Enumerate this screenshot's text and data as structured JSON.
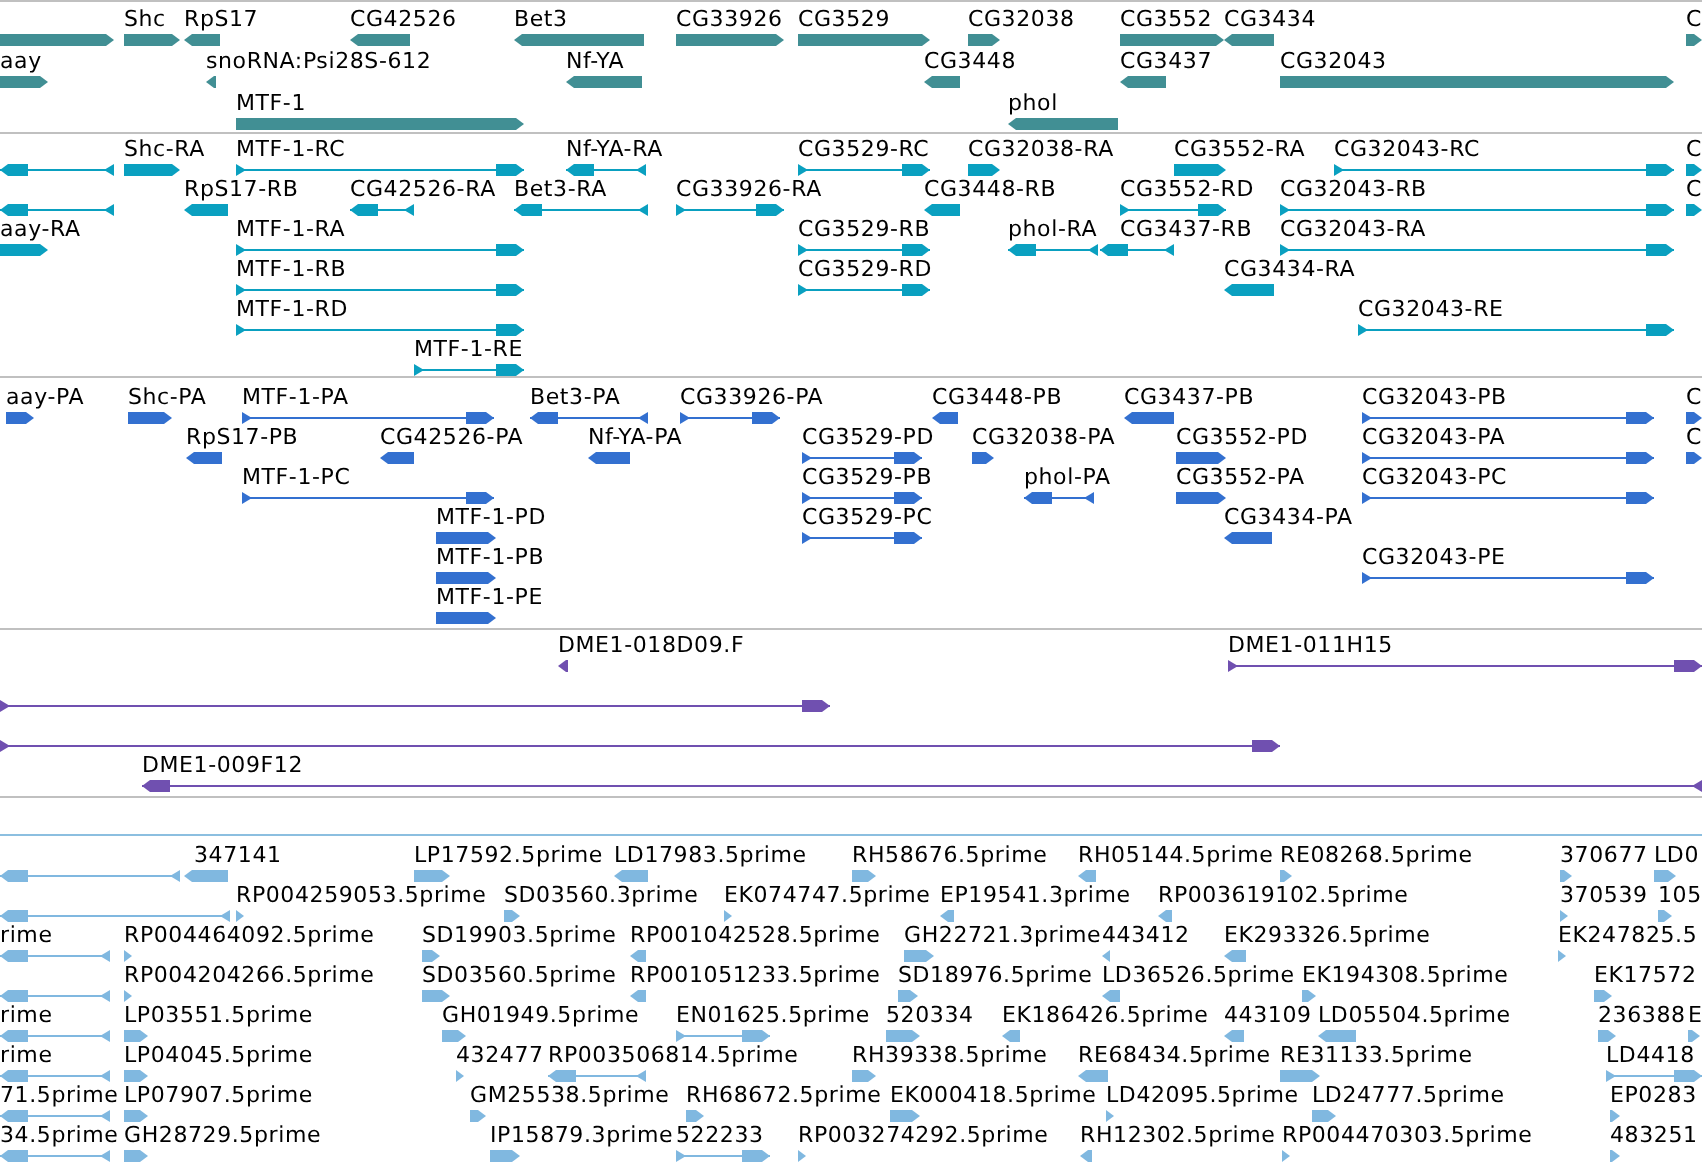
{
  "tracks": [
    {
      "kind": "gene",
      "color": "#418f94",
      "features": [
        {
          "reverse": false
        },
        {
          "label": "Shc",
          "reverse": false
        },
        {
          "label": "RpS17",
          "reverse": true
        },
        {
          "label": "CG42526",
          "reverse": true
        },
        {
          "label": "Bet3",
          "reverse": true
        },
        {
          "label": "CG33926",
          "reverse": false
        },
        {
          "label": "CG3529",
          "reverse": false
        },
        {
          "label": "CG32038",
          "reverse": false
        },
        {
          "label": "CG3552",
          "reverse": false
        },
        {
          "label": "CG3434",
          "reverse": true
        },
        {
          "label": "C",
          "reverse": false
        },
        {
          "label": "aay",
          "reverse": false
        },
        {
          "label": "snoRNA:Psi28S-612",
          "reverse": true
        },
        {
          "label": "Nf-YA",
          "reverse": true
        },
        {
          "label": "CG3448",
          "reverse": true
        },
        {
          "label": "CG3437",
          "reverse": true
        },
        {
          "label": "CG32043",
          "reverse": false
        },
        {
          "label": "MTF-1",
          "reverse": false
        },
        {
          "label": "phol",
          "reverse": true
        }
      ]
    },
    {
      "kind": "transcript",
      "color": "#0aa0c0",
      "features": [
        {
          "reverse": true
        },
        {
          "label": "Shc-RA",
          "reverse": false
        },
        {
          "label": "MTF-1-RC",
          "reverse": false
        },
        {
          "label": "Nf-YA-RA",
          "reverse": true
        },
        {
          "label": "CG3529-RC",
          "reverse": false
        },
        {
          "label": "CG32038-RA",
          "reverse": false
        },
        {
          "label": "CG3552-RA",
          "reverse": false
        },
        {
          "label": "CG32043-RC",
          "reverse": false
        },
        {
          "label": "C",
          "reverse": false
        },
        {
          "reverse": true
        },
        {
          "label": "RpS17-RB",
          "reverse": true
        },
        {
          "label": "CG42526-RA",
          "reverse": true
        },
        {
          "label": "Bet3-RA",
          "reverse": true
        },
        {
          "label": "CG33926-RA",
          "reverse": false
        },
        {
          "label": "CG3448-RB",
          "reverse": true
        },
        {
          "label": "CG3552-RD",
          "reverse": false
        },
        {
          "label": "CG32043-RB",
          "reverse": false
        },
        {
          "label": "C",
          "reverse": false
        },
        {
          "label": "aay-RA",
          "reverse": false
        },
        {
          "label": "MTF-1-RA",
          "reverse": false
        },
        {
          "label": "CG3529-RB",
          "reverse": false
        },
        {
          "label": "phol-RA",
          "reverse": true
        },
        {
          "label": "CG3437-RB",
          "reverse": true
        },
        {
          "label": "CG32043-RA",
          "reverse": false
        },
        {
          "label": "MTF-1-RB",
          "reverse": false
        },
        {
          "label": "CG3529-RD",
          "reverse": false
        },
        {
          "label": "CG3434-RA",
          "reverse": true
        },
        {
          "label": "MTF-1-RD",
          "reverse": false
        },
        {
          "label": "CG32043-RE",
          "reverse": false
        },
        {
          "label": "MTF-1-RE",
          "reverse": false
        }
      ]
    },
    {
      "kind": "protein",
      "color": "#3370d0",
      "features": [
        {
          "label": "aay-PA",
          "reverse": false
        },
        {
          "label": "Shc-PA",
          "reverse": false
        },
        {
          "label": "MTF-1-PA",
          "reverse": false
        },
        {
          "label": "Bet3-PA",
          "reverse": true
        },
        {
          "label": "CG33926-PA",
          "reverse": false
        },
        {
          "label": "CG3448-PB",
          "reverse": true
        },
        {
          "label": "CG3437-PB",
          "reverse": true
        },
        {
          "label": "CG32043-PB",
          "reverse": false
        },
        {
          "label": "C",
          "reverse": false
        },
        {
          "label": "RpS17-PB",
          "reverse": true
        },
        {
          "label": "CG42526-PA",
          "reverse": true
        },
        {
          "label": "Nf-YA-PA",
          "reverse": true
        },
        {
          "label": "CG3529-PD",
          "reverse": false
        },
        {
          "label": "CG32038-PA",
          "reverse": false
        },
        {
          "label": "CG3552-PD",
          "reverse": false
        },
        {
          "label": "CG32043-PA",
          "reverse": false
        },
        {
          "label": "C",
          "reverse": false
        },
        {
          "label": "MTF-1-PC",
          "reverse": false
        },
        {
          "label": "CG3529-PB",
          "reverse": false
        },
        {
          "label": "phol-PA",
          "reverse": true
        },
        {
          "label": "CG3552-PA",
          "reverse": false
        },
        {
          "label": "CG32043-PC",
          "reverse": false
        },
        {
          "label": "MTF-1-PD",
          "reverse": false
        },
        {
          "label": "CG3529-PC",
          "reverse": false
        },
        {
          "label": "CG3434-PA",
          "reverse": true
        },
        {
          "label": "MTF-1-PB",
          "reverse": false
        },
        {
          "label": "CG32043-PE",
          "reverse": false
        },
        {
          "label": "MTF-1-PE",
          "reverse": false
        }
      ]
    },
    {
      "kind": "clone",
      "color": "#7050b0",
      "features": [
        {
          "label": "DME1-018D09.F",
          "reverse": true
        },
        {
          "label": "DME1-011H15",
          "reverse": false
        },
        {
          "reverse": false
        },
        {
          "reverse": false
        },
        {
          "label": "DME1-009F12",
          "reverse": true
        }
      ]
    },
    {
      "kind": "est",
      "color": "#80b8e0",
      "features": [
        {
          "reverse": true
        },
        {
          "label": "347141",
          "reverse": true
        },
        {
          "label": "LP17592.5prime",
          "reverse": false
        },
        {
          "label": "LD17983.5prime",
          "reverse": true
        },
        {
          "label": "RH58676.5prime",
          "reverse": false
        },
        {
          "label": "RH05144.5prime",
          "reverse": true
        },
        {
          "label": "RE08268.5prime",
          "reverse": false
        },
        {
          "label": "370677",
          "reverse": false
        },
        {
          "label": "LD0",
          "reverse": false
        },
        {
          "reverse": true
        },
        {
          "label": "RP004259053.5prime",
          "reverse": false
        },
        {
          "label": "SD03560.3prime",
          "reverse": false
        },
        {
          "label": "EK074747.5prime",
          "reverse": false
        },
        {
          "label": "EP19541.3prime",
          "reverse": true
        },
        {
          "label": "RP003619102.5prime",
          "reverse": true
        },
        {
          "label": "370539",
          "reverse": false
        },
        {
          "label": "105",
          "reverse": false
        },
        {
          "label": "rime",
          "reverse": true
        },
        {
          "label": "RP004464092.5prime",
          "reverse": false
        },
        {
          "label": "SD19903.5prime",
          "reverse": false
        },
        {
          "label": "RP001042528.5prime",
          "reverse": true
        },
        {
          "label": "GH22721.3prime",
          "reverse": false
        },
        {
          "label": "443412",
          "reverse": true
        },
        {
          "label": "EK293326.5prime",
          "reverse": true
        },
        {
          "label": "EK247825.5",
          "reverse": false
        },
        {
          "reverse": true
        },
        {
          "label": "RP004204266.5prime",
          "reverse": false
        },
        {
          "label": "SD03560.5prime",
          "reverse": false
        },
        {
          "label": "RP001051233.5prime",
          "reverse": true
        },
        {
          "label": "SD18976.5prime",
          "reverse": false
        },
        {
          "label": "LD36526.5prime",
          "reverse": true
        },
        {
          "label": "EK194308.5prime",
          "reverse": false
        },
        {
          "label": "EK17572",
          "reverse": false
        },
        {
          "label": "rime",
          "reverse": true
        },
        {
          "label": "LP03551.5prime",
          "reverse": false
        },
        {
          "label": "GH01949.5prime",
          "reverse": false
        },
        {
          "label": "EN01625.5prime",
          "reverse": false
        },
        {
          "label": "520334",
          "reverse": false
        },
        {
          "label": "EK186426.5prime",
          "reverse": true
        },
        {
          "label": "443109",
          "reverse": true
        },
        {
          "label": "LD05504.5prime",
          "reverse": true
        },
        {
          "label": "236388",
          "reverse": false
        },
        {
          "label": "E",
          "reverse": false
        },
        {
          "label": "rime",
          "reverse": true
        },
        {
          "label": "LP04045.5prime",
          "reverse": false
        },
        {
          "label": "432477",
          "reverse": false
        },
        {
          "label": "RP003506814.5prime",
          "reverse": true
        },
        {
          "label": "RH39338.5prime",
          "reverse": false
        },
        {
          "label": "RE68434.5prime",
          "reverse": true
        },
        {
          "label": "RE31133.5prime",
          "reverse": false
        },
        {
          "label": "LD4418",
          "reverse": false
        },
        {
          "label": "71.5prime",
          "reverse": true
        },
        {
          "label": "LP07907.5prime",
          "reverse": false
        },
        {
          "label": "GM25538.5prime",
          "reverse": false
        },
        {
          "label": "RH68672.5prime",
          "reverse": false
        },
        {
          "label": "EK000418.5prime",
          "reverse": false
        },
        {
          "label": "LD42095.5prime",
          "reverse": false
        },
        {
          "label": "LD24777.5prime",
          "reverse": false
        },
        {
          "label": "EP0283",
          "reverse": false
        },
        {
          "label": "34.5prime",
          "reverse": true
        },
        {
          "label": "GH28729.5prime",
          "reverse": false
        },
        {
          "label": "IP15879.3prime",
          "reverse": false
        },
        {
          "label": "522233",
          "reverse": false
        },
        {
          "label": "RP003274292.5prime",
          "reverse": false
        },
        {
          "label": "RH12302.5prime",
          "reverse": true
        },
        {
          "label": "RP004470303.5prime",
          "reverse": false
        },
        {
          "label": "483251",
          "reverse": false
        }
      ]
    }
  ]
}
